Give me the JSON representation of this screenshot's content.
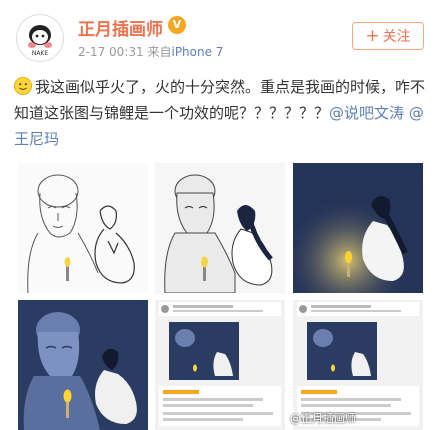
{
  "header": {
    "username": "正月插画师",
    "vip_badge": "V",
    "time": "2-17 00:31",
    "source_prefix": "来自",
    "source": "iPhone 7",
    "follow_label": "关注",
    "follow_plus": "+",
    "avatar_text": "NAKE"
  },
  "post": {
    "emoji_icon": "smile-icon",
    "text": "我这画似乎火了，火的十分突然。重点是我画的时候，咋不知道这张图与锦鲤是一个功效的呢？？？？？？",
    "mention_1": "@说吧文涛",
    "mention_2": "@王尼玛"
  },
  "images": {
    "watermark": "@正月插画师"
  },
  "colors": {
    "accent": "#eb7350",
    "link": "#5d7fb3",
    "night_blue": "#243358"
  }
}
